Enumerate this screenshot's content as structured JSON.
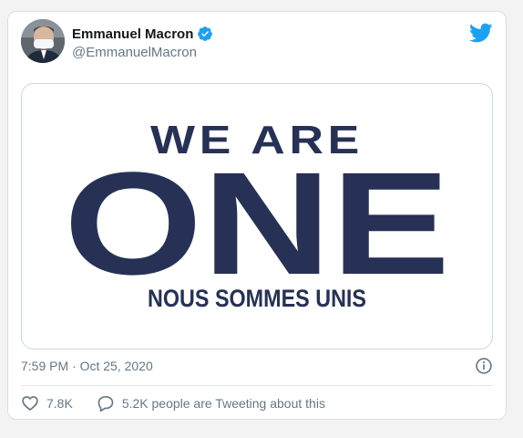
{
  "tweet": {
    "author": {
      "display_name": "Emmanuel Macron",
      "handle": "@EmmanuelMacron",
      "verified": true
    },
    "media": {
      "headline_top": "WE ARE",
      "headline_main": "ONE",
      "subtitle": "NOUS SOMMES UNIS"
    },
    "timestamp": "7:59 PM · Oct 25, 2020",
    "likes_count": "7.8K",
    "conversation_text": "5.2K people are Tweeting about this"
  },
  "icons": {
    "verified": "verified-badge-icon",
    "brand": "twitter-bird-icon",
    "info": "info-icon",
    "like": "heart-icon",
    "reply": "speech-bubble-icon"
  },
  "colors": {
    "brand_blue": "#1da1f2",
    "headline_navy": "#263155",
    "secondary_text": "#657786",
    "primary_text": "#14171a"
  }
}
